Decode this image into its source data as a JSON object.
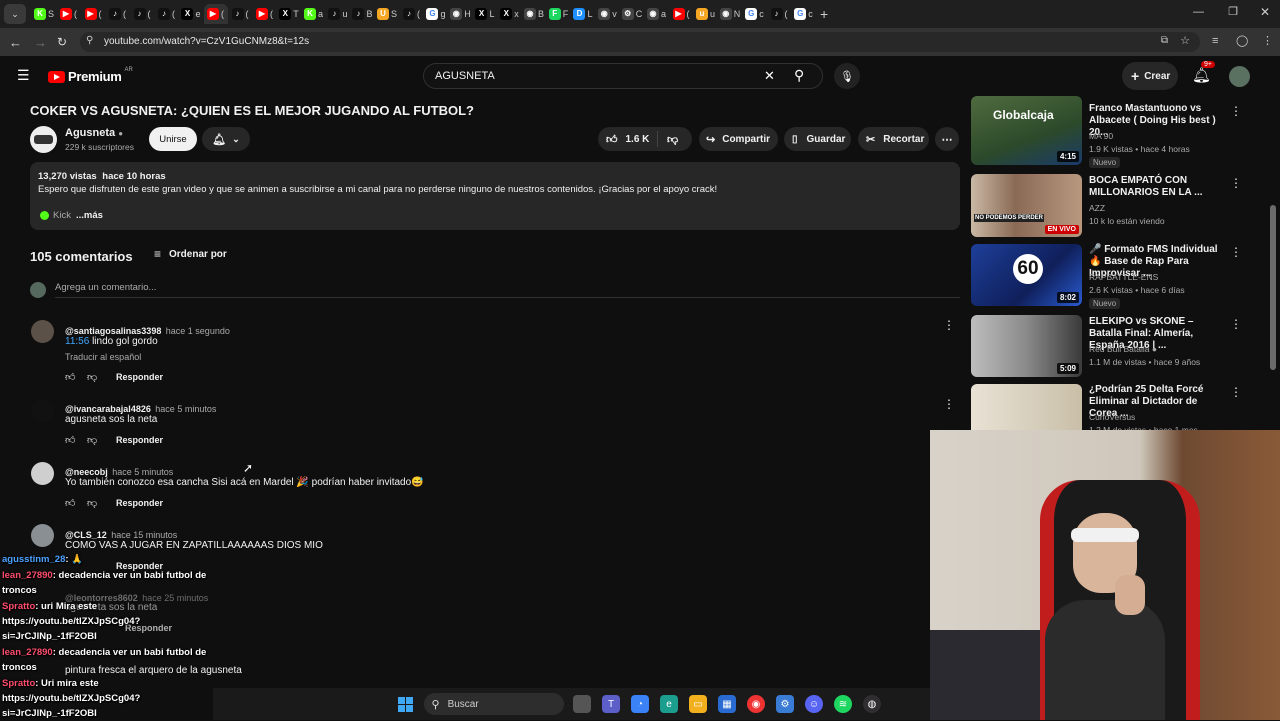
{
  "browser": {
    "tabs": [
      {
        "icon": "kick-icon",
        "letter": "K",
        "color": "#53fc18",
        "label": "S"
      },
      {
        "icon": "youtube-icon",
        "letter": "▶",
        "color": "#ff0000",
        "label": "("
      },
      {
        "icon": "youtube-icon",
        "letter": "▶",
        "color": "#ff0000",
        "label": "("
      },
      {
        "icon": "tiktok-icon",
        "letter": "♪",
        "color": "#111",
        "label": "("
      },
      {
        "icon": "tiktok-icon",
        "letter": "♪",
        "color": "#111",
        "label": "("
      },
      {
        "icon": "tiktok-icon",
        "letter": "♪",
        "color": "#111",
        "label": "("
      },
      {
        "icon": "x-icon",
        "letter": "X",
        "color": "#000",
        "label": "e"
      },
      {
        "icon": "youtube-icon",
        "letter": "▶",
        "color": "#ff0000",
        "label": "("
      },
      {
        "icon": "tiktok-icon",
        "letter": "♪",
        "color": "#111",
        "label": "("
      },
      {
        "icon": "youtube-icon",
        "letter": "▶",
        "color": "#ff0000",
        "label": "("
      },
      {
        "icon": "x-icon",
        "letter": "X",
        "color": "#000",
        "label": "T"
      },
      {
        "icon": "kick-icon",
        "letter": "K",
        "color": "#53fc18",
        "label": "a"
      },
      {
        "icon": "tiktok-icon",
        "letter": "♪",
        "color": "#111",
        "label": "u"
      },
      {
        "icon": "tiktok-icon",
        "letter": "♪",
        "color": "#111",
        "label": "B"
      },
      {
        "icon": "u-icon",
        "letter": "U",
        "color": "#f5a623",
        "label": "S"
      },
      {
        "icon": "tiktok-icon",
        "letter": "♪",
        "color": "#111",
        "label": "("
      },
      {
        "icon": "google-icon",
        "letter": "G",
        "color": "#fff",
        "label": "g"
      },
      {
        "icon": "generic-icon",
        "letter": "◉",
        "color": "#444",
        "label": "H"
      },
      {
        "icon": "x-icon",
        "letter": "X",
        "color": "#000",
        "label": "L"
      },
      {
        "icon": "x-icon",
        "letter": "X",
        "color": "#000",
        "label": "x"
      },
      {
        "icon": "generic-icon",
        "letter": "◉",
        "color": "#444",
        "label": "B"
      },
      {
        "icon": "f-icon",
        "letter": "F",
        "color": "#1ed760",
        "label": "F"
      },
      {
        "icon": "d-icon",
        "letter": "D",
        "color": "#1e90ff",
        "label": "L"
      },
      {
        "icon": "generic-icon",
        "letter": "◉",
        "color": "#444",
        "label": "v"
      },
      {
        "icon": "gear-icon",
        "letter": "⚙",
        "color": "#444",
        "label": "C"
      },
      {
        "icon": "generic-icon",
        "letter": "◉",
        "color": "#444",
        "label": "a"
      },
      {
        "icon": "youtube-icon",
        "letter": "▶",
        "color": "#ff0000",
        "label": "("
      },
      {
        "icon": "u-icon",
        "letter": "u",
        "color": "#f5a623",
        "label": "u"
      },
      {
        "icon": "generic-icon",
        "letter": "◉",
        "color": "#444",
        "label": "N"
      },
      {
        "icon": "google-icon",
        "letter": "G",
        "color": "#fff",
        "label": "c"
      },
      {
        "icon": "tiktok-icon",
        "letter": "♪",
        "color": "#111",
        "label": "("
      },
      {
        "icon": "google-icon",
        "letter": "G",
        "color": "#fff",
        "label": "c"
      }
    ],
    "url": "youtube.com/watch?v=CzV1GuCNMz8&t=12s"
  },
  "header": {
    "logo": "Premium",
    "region": "AR",
    "search_value": "AGUSNETA",
    "create_label": "Crear",
    "notif_count": "9+"
  },
  "video": {
    "title": "COKER VS AGUSNETA: ¿QUIEN ES EL MEJOR JUGANDO AL FUTBOL?",
    "channel": "Agusneta",
    "subscribers": "229 k suscriptores",
    "join_label": "Unirse",
    "likes": "1.6 K",
    "share_label": "Compartir",
    "save_label": "Guardar",
    "clip_label": "Recortar",
    "views": "13,270 vistas",
    "published": "hace 10 horas",
    "description": "Espero que disfruten de este gran video y que se animen a suscribirse a mi canal para no perderse ninguno de nuestros contenidos. ¡Gracias por el apoyo crack!",
    "kick_label": "Kick",
    "more_label": "...más"
  },
  "comments": {
    "count_label": "105 comentarios",
    "sort_label": "Ordenar por",
    "add_placeholder": "Agrega un comentario...",
    "reply_label": "Responder",
    "translate_label": "Traducir al español",
    "items": [
      {
        "handle": "@santiagosalinas3398",
        "time": "hace 1 segundo",
        "timestamp": "11:56",
        "text": "lindo gol gordo"
      },
      {
        "handle": "@ivancarabajal4826",
        "time": "hace 5 minutos",
        "text": "agusneta sos la neta"
      },
      {
        "handle": "@neecobj",
        "time": "hace 5 minutos",
        "text": "Yo también conozco esa cancha Sisi acá en Mardel 🎉 podrían haber invitado😅"
      },
      {
        "handle": "@CLS_12",
        "time": "hace 15 minutos",
        "text": "COMO VAS A JUGAR EN ZAPATILLAAAAAAS DIOS MIO"
      },
      {
        "handle": "@leontorres8602",
        "time": "hace 25 minutos",
        "text": "agusneta sos la neta"
      },
      {
        "text": "pintura fresca el arquero de la agusneta"
      }
    ]
  },
  "sidebar": {
    "items": [
      {
        "title": "Franco Mastantuono vs Albacete ( Doing His best ) 20...",
        "channel": "MA 90",
        "meta": "1.9 K vistas • hace 4 horas",
        "duration": "4:15",
        "badge": "Nuevo",
        "thumb_text": "Globalcaja"
      },
      {
        "title": "BOCA EMPATÓ CON MILLONARIOS EN LA ...",
        "channel": "AZZ",
        "meta": "10 k lo están viendo",
        "live": "EN VIVO",
        "thumb_text": "NO PODEMOS PERDER"
      },
      {
        "title": "🎤 Formato FMS Individual 🔥 Base de Rap Para Improvisar ...",
        "channel": "RAPBATTLE-ENS",
        "meta": "2.6 K vistas • hace 6 días",
        "duration": "8:02",
        "badge": "Nuevo",
        "thumb_text": "60"
      },
      {
        "title": "ELEKIPO vs SKONE – Batalla Final: Almería, España 2016 | ...",
        "channel": "Red Bull Batalla",
        "meta": "1.1 M de vistas • hace 9 años",
        "duration": "5:09"
      },
      {
        "title": "¿Podrían 25 Delta Forcé Eliminar al Dictador de Corea ...",
        "channel": "CurioVersus",
        "meta": "1.2 M de vistas • hace 1 mes"
      }
    ]
  },
  "chat": {
    "lines": [
      {
        "user": "agusstinm_28",
        "user_color": "#4da3ff",
        "text": ": 🙏"
      },
      {
        "user": "lean_27890",
        "user_color": "#ff4d6d",
        "text": ": decadencia ver un babi futbol de troncos"
      },
      {
        "user": "Spratto",
        "user_color": "#ff4d6d",
        "text": ": uri Mira este https://youtu.be/tIZXJpSCg04?si=JrCJlNp_-1fF2OBI"
      },
      {
        "user": "lean_27890",
        "user_color": "#ff4d6d",
        "text": ": decadencia ver un babi futbol de troncos"
      },
      {
        "user": "Spratto",
        "user_color": "#ff4d6d",
        "text": ": Uri mira este https://youtu.be/tIZXJpSCg04?si=JrCJlNp_-1fF2OBI"
      }
    ]
  },
  "taskbar": {
    "search_label": "Buscar"
  }
}
